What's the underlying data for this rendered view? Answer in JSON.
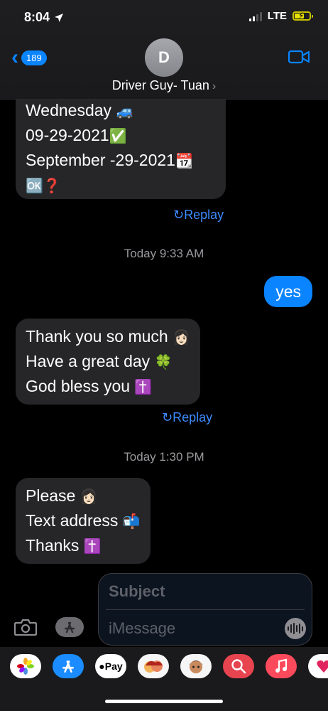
{
  "status": {
    "time": "8:04",
    "network": "LTE"
  },
  "header": {
    "back_count": "189",
    "avatar_letter": "D",
    "contact_name": "Driver Guy- Tuan"
  },
  "messages": {
    "m1": {
      "line1": "Wednesday",
      "line1_emoji": "🚙",
      "line2": "09-29-2021",
      "line2_emoji": "✅",
      "line3": "September -29-2021",
      "line3_emoji": "📆",
      "line4_emoji": "🆗❓"
    },
    "replay1": "↻Replay",
    "ts1": "Today 9:33 AM",
    "out1": "yes",
    "m2": {
      "line1": "Thank you so much",
      "line1_emoji": "👩🏻",
      "line2": "Have a great day",
      "line2_emoji": "🍀",
      "line3": "God bless you",
      "line3_emoji": "✝️"
    },
    "replay2": "↻Replay",
    "ts2": "Today 1:30 PM",
    "m3": {
      "line1": "Please",
      "line1_emoji": "👩🏻",
      "line2": "Text address",
      "line2_emoji": "📬",
      "line3": "Thanks",
      "line3_emoji": "✝️"
    }
  },
  "composer": {
    "subject_placeholder": "Subject",
    "message_placeholder": "iMessage"
  },
  "apps": [
    "Photos",
    "App Store",
    "Apple Pay",
    "Memoji Stickers",
    "Animoji",
    "Search",
    "Music",
    "Heartbeat"
  ],
  "apps_labels": {
    "pay": "Pay"
  },
  "colors": {
    "accent": "#0a84ff",
    "incoming_bubble": "#262628"
  }
}
